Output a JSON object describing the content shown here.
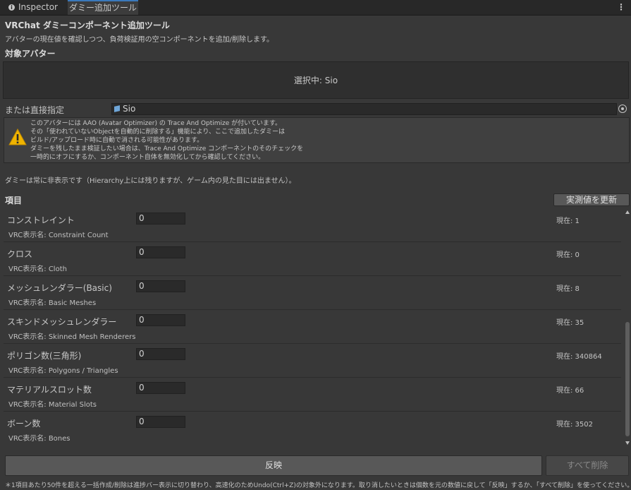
{
  "tabs": [
    {
      "label": "Inspector"
    },
    {
      "label": "ダミー追加ツール"
    }
  ],
  "tab_menu_icon": "kebab-menu-icon",
  "header": {
    "title": "VRChat ダミーコンポーネント追加ツール",
    "subtitle": "アバターの現在値を確認しつつ、負荷検証用の空コンポーネントを追加/削除します。"
  },
  "target": {
    "section_label": "対象アバター",
    "selected_text": "選択中: Sio",
    "direct_label": "または直接指定",
    "object_value": "Sio"
  },
  "warning": {
    "icon": "warning-icon",
    "lines": [
      "このアバターには AAO (Avatar Optimizer) の Trace And Optimize が付いています。",
      "その「使われていないObjectを自動的に削除する」機能により、ここで追加したダミーは",
      "ビルド/アップロード時に自動で消される可能性があります。",
      "ダミーを残したまま検証したい場合は、Trace And Optimize コンポーネントのそのチェックを",
      "一時的にオフにするか、コンポーネント自体を無効化してから確認してください。"
    ]
  },
  "hidden_note": "ダミーは常に非表示です（Hierarchy上には残りますが、ゲーム内の見た目には出ません）。",
  "items_section": {
    "label": "項目",
    "refresh_button": "実測値を更新"
  },
  "items": [
    {
      "name": "コンストレイント",
      "vrc": "VRC表示名: Constraint Count",
      "value": "0",
      "current": "現在: 1"
    },
    {
      "name": "クロス",
      "vrc": "VRC表示名: Cloth",
      "value": "0",
      "current": "現在: 0"
    },
    {
      "name": "メッシュレンダラー(Basic)",
      "vrc": "VRC表示名: Basic Meshes",
      "value": "0",
      "current": "現在: 8"
    },
    {
      "name": "スキンドメッシュレンダラー",
      "vrc": "VRC表示名: Skinned Mesh Renderers",
      "value": "0",
      "current": "現在: 35"
    },
    {
      "name": "ポリゴン数(三角形)",
      "vrc": "VRC表示名: Polygons / Triangles",
      "value": "0",
      "current": "現在: 340864"
    },
    {
      "name": "マテリアルスロット数",
      "vrc": "VRC表示名: Material Slots",
      "value": "0",
      "current": "現在: 66"
    },
    {
      "name": "ボーン数",
      "vrc": "VRC表示名: Bones",
      "value": "0",
      "current": "現在: 3502"
    }
  ],
  "actions": {
    "apply": "反映",
    "delete_all": "すべて削除"
  },
  "footnote": "＊1項目あたり50件を超える一括作成/削除は進捗バー表示に切り替わり、高速化のためUndo(Ctrl+Z)の対象外になります。取り消したいときは個数を元の数値に戻して「反映」するか、「すべて削除」を使ってください。",
  "colors": {
    "background": "#383838",
    "tab_active_accent": "#3a79bb",
    "warning": "#f0b400"
  }
}
